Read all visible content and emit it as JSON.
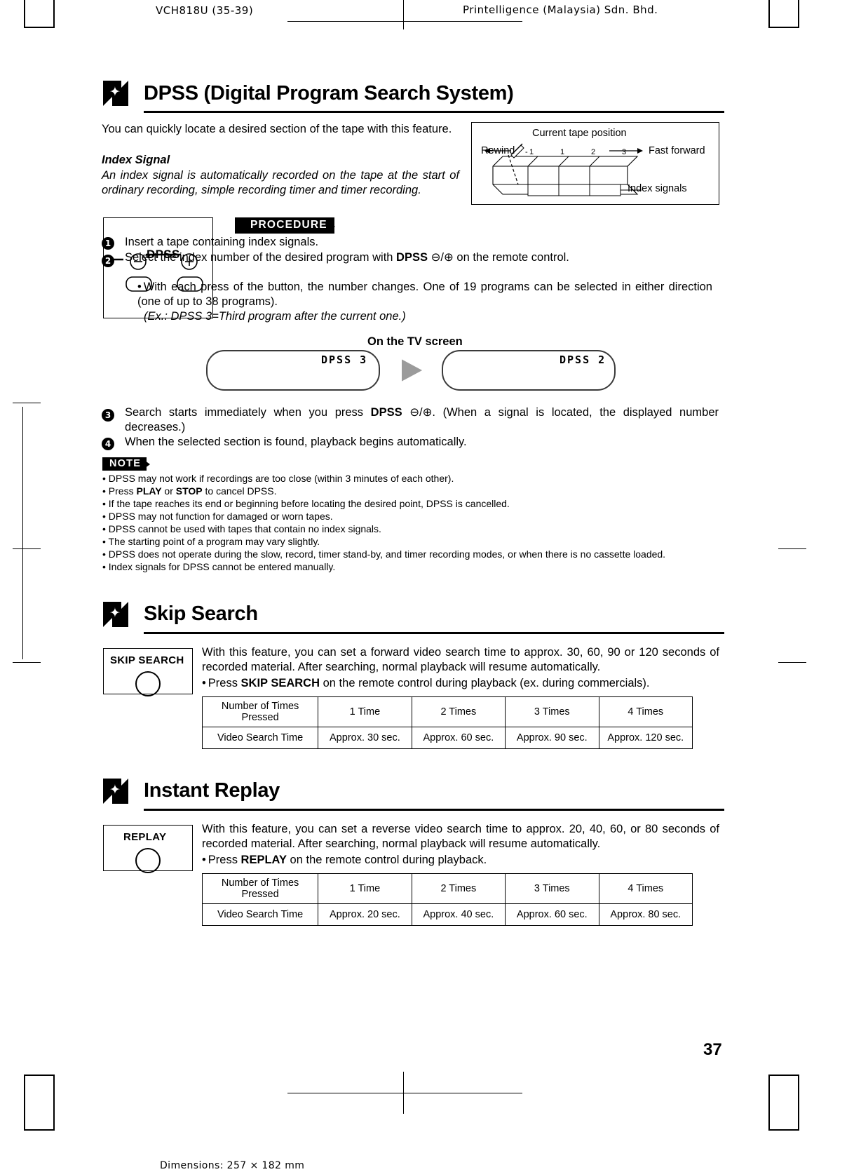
{
  "header": {
    "left": "VCH818U (35-39)",
    "right": "Printelligence (Malaysia) Sdn. Bhd."
  },
  "footer": {
    "dimensions": "Dimensions: 257  ×  182 mm",
    "page_number": "37"
  },
  "sections": [
    {
      "title": "DPSS (Digital Program Search System)",
      "intro": "You can quickly locate a desired section of the tape with this feature.",
      "subhead": "Index Signal",
      "subtext": "An index signal is automatically recorded on the tape at the start of ordinary recording, simple recording timer and timer recording.",
      "diagram": {
        "title": "Current tape position",
        "rewind": "Rewind",
        "fast_forward": "Fast forward",
        "index_signals": "Index signals",
        "ticks": [
          "1",
          "1",
          "2",
          "3"
        ]
      },
      "keybox_label": "DPSS",
      "banner": "PROCEDURE",
      "steps": [
        {
          "num": "1",
          "text": "Insert a tape containing index signals."
        },
        {
          "num": "2",
          "text_a": "Select the index number of the desired program with ",
          "text_b": "DPSS",
          "text_c": " ⊖/⊕ on the remote control.",
          "bullets": [
            "With each press of the button, the number changes. One of 19 programs can be selected in either direction (one of up to 38 programs).",
            "(Ex.: DPSS 3=Third program after the current one.)"
          ]
        },
        {
          "num": "3",
          "text_a": "Search starts immediately when you press ",
          "text_b": "DPSS",
          "text_c": " ⊖/⊕. (When a signal is located, the displayed number decreases.)"
        },
        {
          "num": "4",
          "text": "When the selected section is found, playback begins automatically."
        }
      ],
      "tv": {
        "caption": "On the TV screen",
        "screen_left": "DPSS   3",
        "screen_right": "DPSS   2"
      },
      "note_banner": "NOTE",
      "notes": [
        "DPSS may not work if recordings are too close (within 3 minutes of each other).",
        "Press PLAY or STOP to cancel DPSS.",
        "If the tape reaches its end or beginning before locating the desired point, DPSS is cancelled.",
        "DPSS may not function for damaged or worn tapes.",
        "DPSS cannot be used with tapes that contain no index signals.",
        "The starting point of a program may vary slightly.",
        "DPSS does not operate during the slow, record, timer stand-by, and timer recording modes, or when there is no cassette loaded.",
        "Index signals for DPSS cannot be entered manually."
      ]
    },
    {
      "title": "Skip Search",
      "button_label": "SKIP SEARCH",
      "intro": "With this feature, you can set a forward video search time to approx. 30, 60, 90 or 120 seconds of recorded material. After searching, normal playback will resume automatically.",
      "bullet_a": "Press ",
      "bullet_b": "SKIP SEARCH",
      "bullet_c": " on the remote control during playback (ex. during commercials).",
      "table": {
        "rows": [
          [
            "Number of Times Pressed",
            "1 Time",
            "2 Times",
            "3 Times",
            "4 Times"
          ],
          [
            "Video Search Time",
            "Approx. 30 sec.",
            "Approx. 60 sec.",
            "Approx. 90 sec.",
            "Approx. 120 sec."
          ]
        ]
      }
    },
    {
      "title": "Instant Replay",
      "button_label": "REPLAY",
      "intro": "With this feature, you can set a reverse video search time to approx. 20, 40, 60, or 80 seconds of recorded material. After searching, normal playback will resume automatically.",
      "bullet_a": "Press ",
      "bullet_b": "REPLAY",
      "bullet_c": " on the remote control during playback.",
      "table": {
        "rows": [
          [
            "Number of Times Pressed",
            "1 Time",
            "2 Times",
            "3 Times",
            "4 Times"
          ],
          [
            "Video Search Time",
            "Approx. 20 sec.",
            "Approx. 40 sec.",
            "Approx. 60 sec.",
            "Approx. 80 sec."
          ]
        ]
      }
    }
  ]
}
